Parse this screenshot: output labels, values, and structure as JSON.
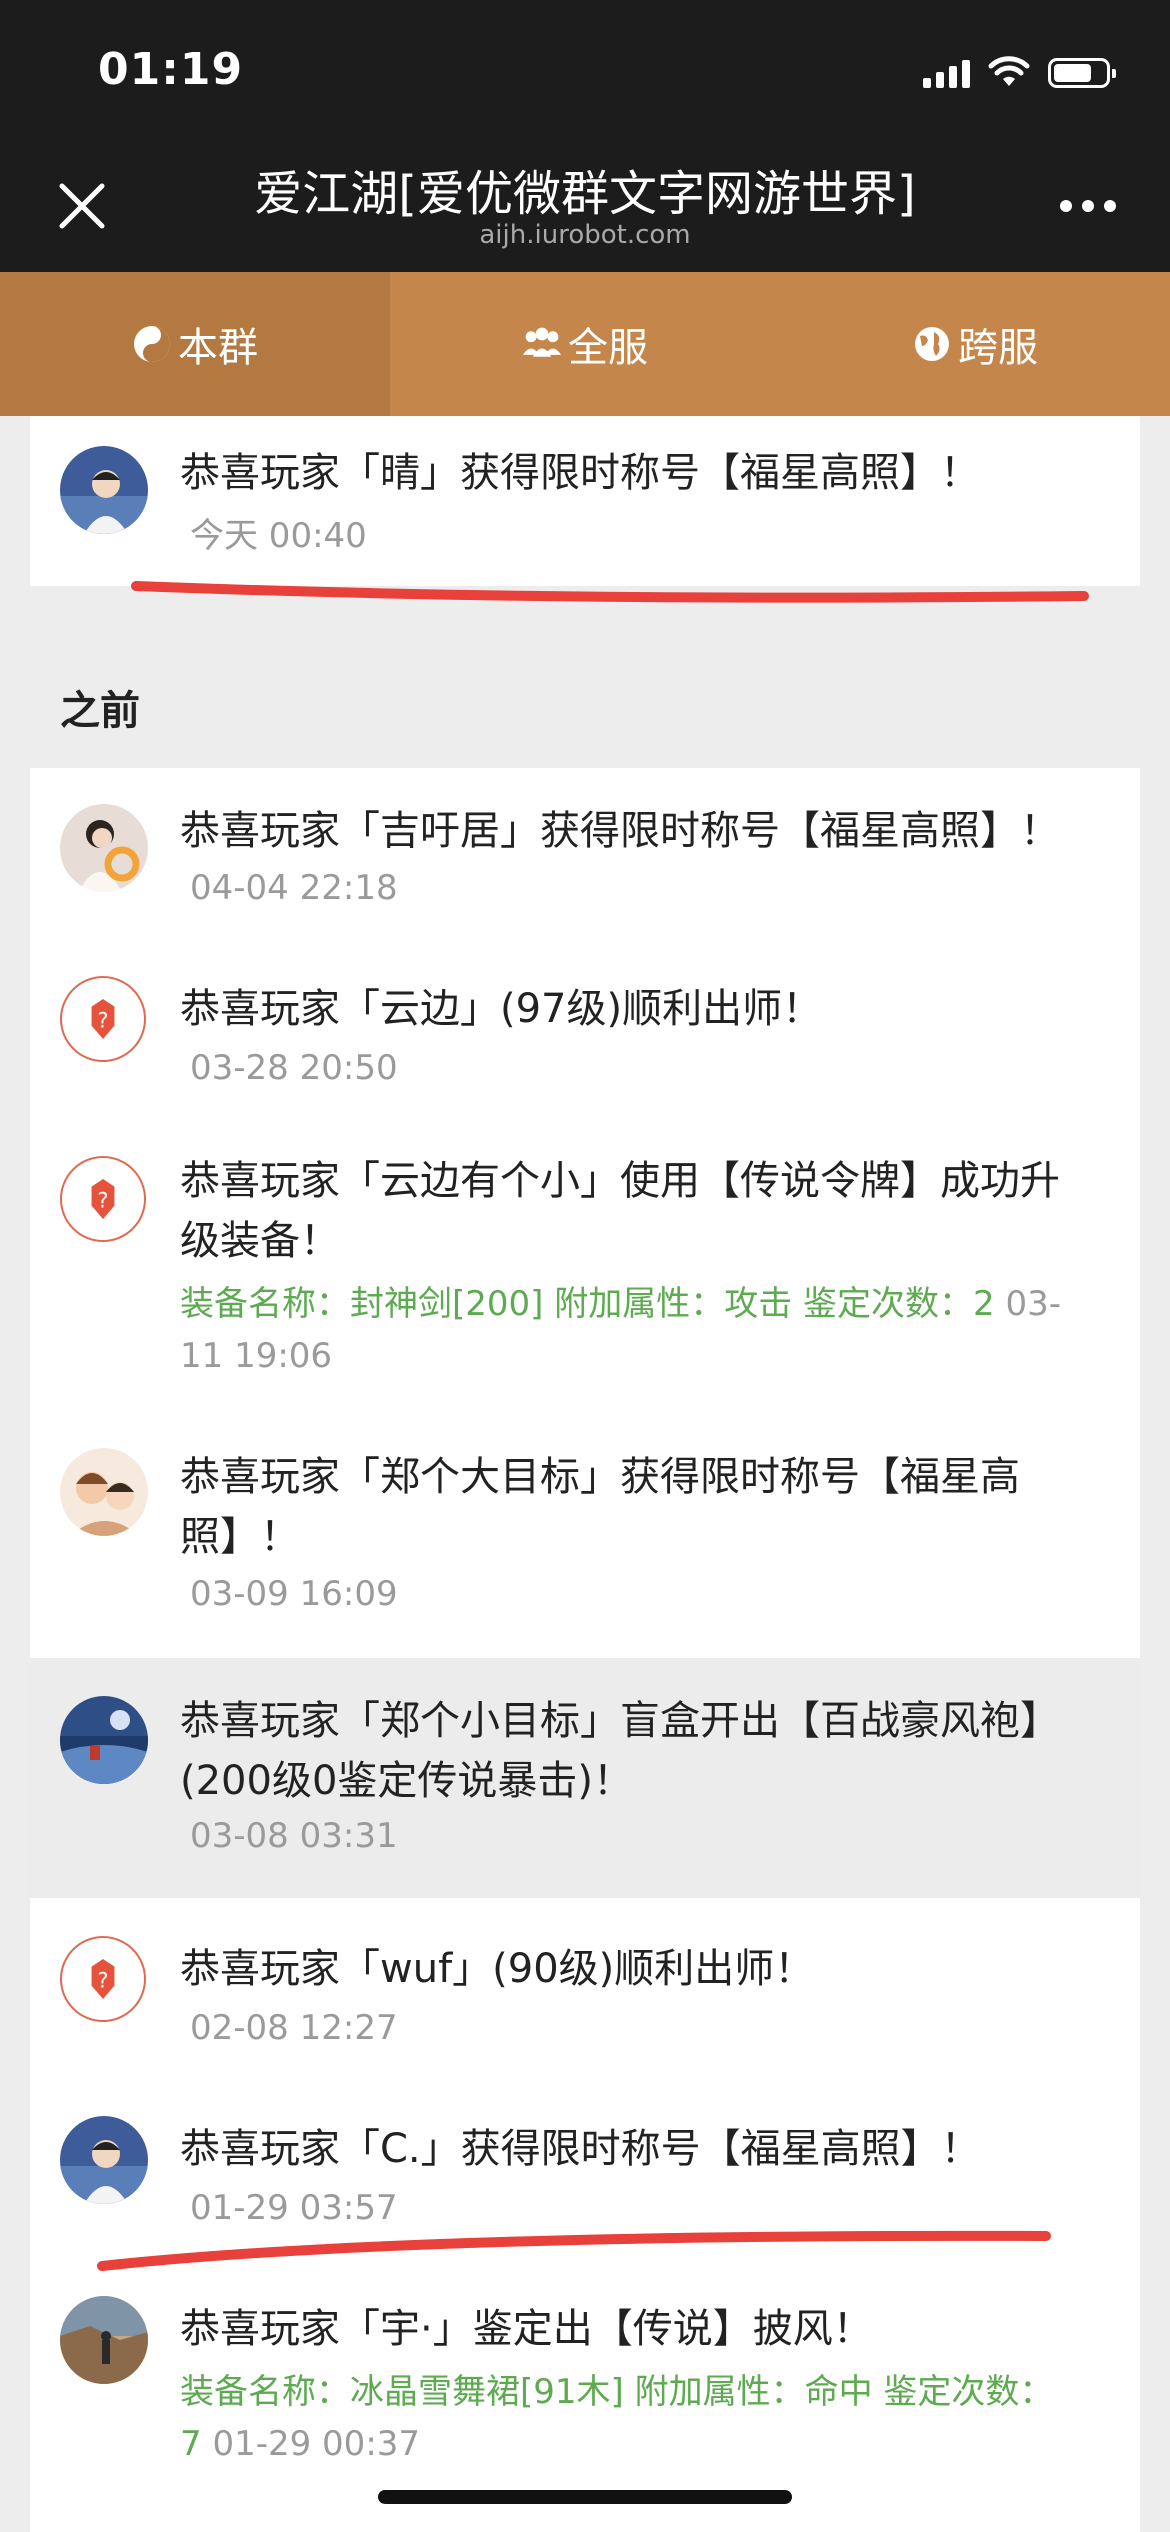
{
  "status": {
    "time": "01:19"
  },
  "nav": {
    "title": "爱江湖[爱优微群文字网游世界]",
    "subtitle": "aijh.iurobot.com"
  },
  "tabs": [
    {
      "label": "本群",
      "icon": "yin-yang-icon",
      "active": true
    },
    {
      "label": "全服",
      "icon": "users-icon",
      "active": false
    },
    {
      "label": "跨服",
      "icon": "globe-icon",
      "active": false
    }
  ],
  "today": [
    {
      "text": "恭喜玩家「晴」获得限时称号【福星高照】！",
      "time": "今天 00:40",
      "avatar": "avatar-photo"
    }
  ],
  "section_title": "之前",
  "earlier": [
    {
      "lines": [
        "恭喜玩家「吉吁居」获得限时称号【福星高照】！"
      ],
      "time": "04-04 22:18",
      "avatar": "avatar-photo"
    },
    {
      "lines": [
        "恭喜玩家「云边」(97级)顺利出师！"
      ],
      "time": "03-28 20:50",
      "avatar": "badge-icon"
    },
    {
      "lines": [
        "恭喜玩家「云边有个小」使用【传说令牌】成功升",
        "级装备！"
      ],
      "detail": [
        "装备名称：封神剑[200] 附加属性：攻击 鉴定次数：2",
        "11 19:06"
      ],
      "detail_time_tail": " 03-",
      "avatar": "badge-icon"
    },
    {
      "lines": [
        "恭喜玩家「郑个大目标」获得限时称号【福星高",
        "照】！"
      ],
      "time": "03-09 16:09",
      "avatar": "avatar-photo"
    },
    {
      "lines": [
        "恭喜玩家「郑个小目标」盲盒开出【百战豪风袍】",
        "(200级0鉴定传说暴击)！"
      ],
      "time": "03-08 03:31",
      "avatar": "avatar-photo"
    },
    {
      "lines": [
        "恭喜玩家「wuf」(90级)顺利出师！"
      ],
      "time": "02-08 12:27",
      "avatar": "badge-icon"
    },
    {
      "lines": [
        "恭喜玩家「C.」获得限时称号【福星高照】！"
      ],
      "time": "01-29 03:57",
      "avatar": "avatar-photo"
    },
    {
      "lines": [
        "恭喜玩家「宇·」鉴定出【传说】披风！"
      ],
      "detail": [
        "装备名称：冰晶雪舞裙[91木] 附加属性：命中 鉴定次数：",
        "7"
      ],
      "detail_time_tail": " 01-29 00:37",
      "avatar": "avatar-photo"
    }
  ],
  "colors": {
    "tab_bar": "#c4864a",
    "tab_active": "#b47940",
    "detail_green": "#5eaa51",
    "highlight_line": "#e8403a"
  }
}
